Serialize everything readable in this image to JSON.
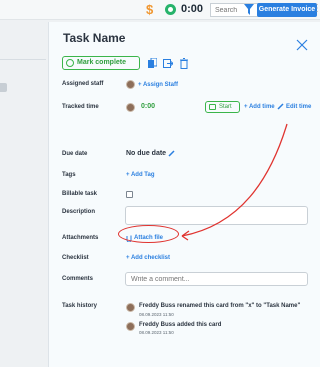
{
  "topbar": {
    "currency_symbol": "$",
    "timer_value": "0:00",
    "search_placeholder": "Search",
    "generate_label": "Generate Invoice",
    "more_symbol": "⋮"
  },
  "task": {
    "title": "Task Name",
    "mark_complete": "Mark complete",
    "fields": {
      "assigned_staff": "Assigned staff",
      "tracked_time": "Tracked time",
      "due_date": "Due date",
      "tags": "Tags",
      "billable": "Billable task",
      "description": "Description",
      "attachments": "Attachments",
      "checklist": "Checklist",
      "comments": "Comments",
      "history": "Task history"
    },
    "assign_staff": "+  Assign Staff",
    "tracked_value": "0:00",
    "start_label": "Start",
    "add_time": "+  Add time",
    "edit_time": "Edit time",
    "due_value": "No due date",
    "add_tag": "+  Add Tag",
    "attach_file": "Attach file",
    "add_checklist": "+  Add checklist",
    "comment_placeholder": "Write a comment...",
    "history": [
      {
        "text": "Freddy Buss renamed this card from \"x\" to \"Task Name\"",
        "date": "08.09.2023 11:50"
      },
      {
        "text": "Freddy Buss added this card",
        "date": "08.09.2023 11:50"
      }
    ]
  },
  "colors": {
    "accent": "#2a7fe0",
    "green": "#3bb54a",
    "annotation": "#e0332f"
  }
}
